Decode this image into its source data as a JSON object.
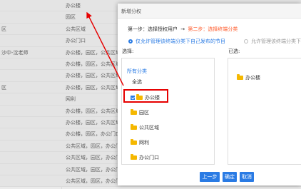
{
  "table": {
    "rows": [
      {
        "c1": "",
        "c2": "办公楼"
      },
      {
        "c1": "",
        "c2": "园区"
      },
      {
        "c1": "区",
        "c2": "公共区域"
      },
      {
        "c1": "",
        "c2": "办公门口"
      },
      {
        "c1": "沙中-沈老师",
        "c2": "办公楼，园区，公共区域"
      },
      {
        "c1": "",
        "c2": "办公楼，园区，公共区域"
      },
      {
        "c1": "",
        "c2": "办公楼，园区，公共区域"
      },
      {
        "c1": "区",
        "c2": "办公楼，园区，公共区域"
      },
      {
        "c1": "",
        "c2": "网利"
      },
      {
        "c1": "",
        "c2": "办公楼，园区，公共区域"
      },
      {
        "c1": "",
        "c2": "办公楼，园区，公共区域"
      },
      {
        "c1": "",
        "c2": "办公楼，园区，办公门口"
      },
      {
        "c1": "",
        "c2": "公共区域，园区，办公门口"
      },
      {
        "c1": "",
        "c2": "公共区域，园区，办公门口"
      },
      {
        "c1": "",
        "c2": "公共区域，园区，办公门口"
      },
      {
        "c1": "",
        "c2": "公共区域，园区，办公门口"
      }
    ]
  },
  "modal": {
    "title": "新增分权",
    "step1": "第一步：选择授权用户",
    "arrow": "→",
    "step2": "第二步：选择终端分类",
    "radio_selected": "仅允许管理该终端分类下自己发布的节目",
    "radio_other": "允许管理该终端分类下所有",
    "select_label": "选择:",
    "selected_label": "已选:",
    "tree_head": "所有分类",
    "tree_all": "全选",
    "tree_items": [
      {
        "label": "办公楼",
        "checked": true
      },
      {
        "label": "园区",
        "checked": false
      },
      {
        "label": "公共区域",
        "checked": false
      },
      {
        "label": "网利",
        "checked": false
      },
      {
        "label": "办公门口",
        "checked": false
      }
    ],
    "selected_items": [
      "办公楼"
    ],
    "buttons": {
      "prev": "上一步",
      "ok": "确定",
      "cancel": "取消"
    }
  },
  "colors": {
    "accent": "#2a7be4",
    "highlight": "#e60000",
    "step2": "#ff5a2a",
    "folder": "#f5b800"
  },
  "icons": {
    "folder": "folder-icon",
    "checkbox": "checkbox-icon",
    "radio": "radio-icon"
  }
}
